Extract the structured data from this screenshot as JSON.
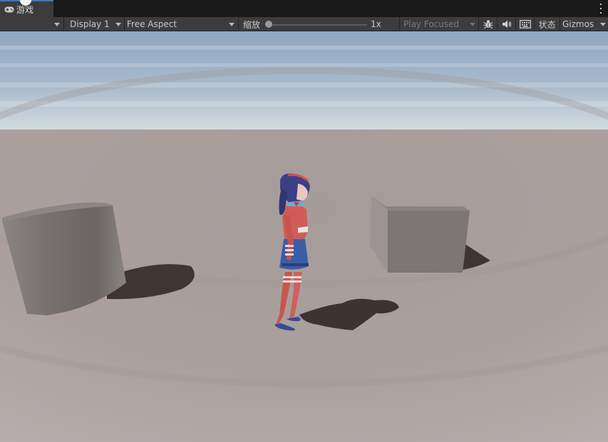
{
  "window": {
    "tab_label": "游戏",
    "tab_icon": "gamepad-icon"
  },
  "toolbar": {
    "display_label": "Display 1",
    "aspect_label": "Free Aspect",
    "scale_label": "缩放",
    "scale_value": "1x",
    "scale_fraction": 0,
    "play_mode_label": "Play Focused",
    "bug_icon": "bug-icon",
    "audio_icon": "speaker-icon",
    "stats_icon": "keyboard-grid-icon",
    "stats_label": "状态",
    "gizmos_label": "Gizmos"
  },
  "colors": {
    "tab_accent": "#3a79bb",
    "toolbar_bg": "#3c3c3c",
    "sky_top": "#8ea6c3",
    "sky_horizon": "#d4dde1",
    "ground": "#aaa19f"
  }
}
